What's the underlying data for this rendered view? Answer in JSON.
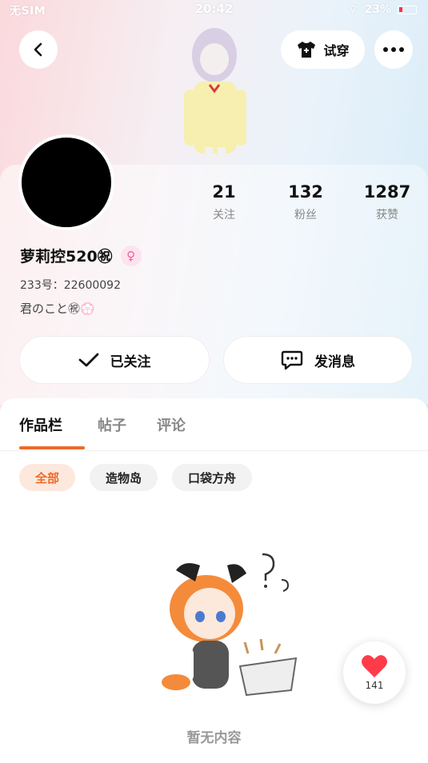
{
  "status_bar": {
    "carrier": "无SIM",
    "time": "20:42",
    "battery": "23%"
  },
  "header": {
    "try_on_label": "试穿"
  },
  "profile": {
    "stats": [
      {
        "value": "21",
        "label": "关注"
      },
      {
        "value": "132",
        "label": "粉丝"
      },
      {
        "value": "1287",
        "label": "获赞"
      }
    ],
    "nickname": "萝莉控520㊗",
    "gender_symbol": "♀",
    "uid": "233号：22600092",
    "bio": "君のこと㊗💮"
  },
  "actions": {
    "followed_label": "已关注",
    "message_label": "发消息"
  },
  "tabs": [
    "作品栏",
    "帖子",
    "评论"
  ],
  "chips": [
    "全部",
    "造物岛",
    "口袋方舟"
  ],
  "empty_text": "暂无内容",
  "like": {
    "count": "141"
  },
  "colors": {
    "accent": "#f06a28",
    "like_red": "#ff3b4a",
    "gender_pink": "#f0609a"
  }
}
